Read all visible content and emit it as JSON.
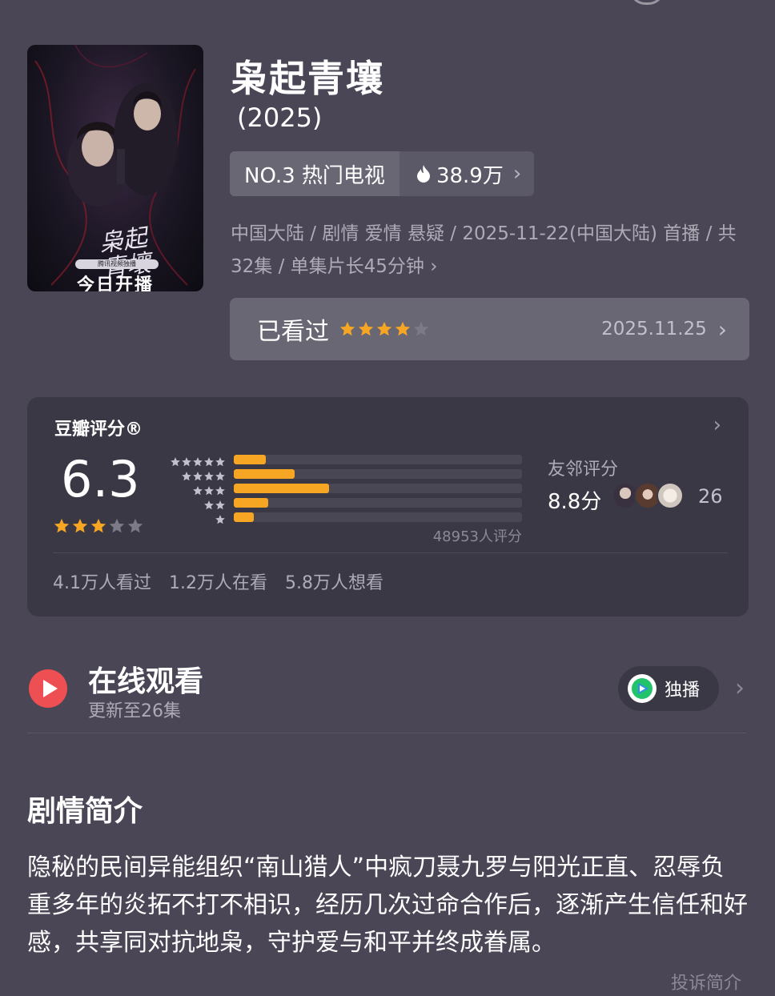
{
  "show": {
    "title": "枭起青壤",
    "year": "(2025)",
    "rank_label": "NO.3 热门电视",
    "heat": "38.9万",
    "meta_line1": "中国大陆 / 剧情 爱情 悬疑 / 2025-11-22(中国大陆) 首播 / 共",
    "meta_line2": "32集 / 单集片长45分钟",
    "poster": {
      "vertical_title": "枭起青壤",
      "banner": "腾讯视频独播",
      "today": "今日开播"
    }
  },
  "watched": {
    "label": "已看过",
    "user_rating_stars": 4,
    "date": "2025.11.25"
  },
  "rating": {
    "brand": "豆瓣评分®",
    "score": "6.3",
    "score_stars": 3,
    "distribution_percent": [
      11,
      21,
      33,
      12,
      7
    ],
    "votes": "48953人评分",
    "friends_label": "友邻评分",
    "friends_score": "8.8分",
    "friends_count": "26",
    "seen": "4.1万人看过",
    "watching": "1.2万人在看",
    "want": "5.8万人想看"
  },
  "online": {
    "title": "在线观看",
    "subtitle": "更新至26集",
    "exclusive_label": "独播"
  },
  "synopsis": {
    "heading": "剧情简介",
    "text": "隐秘的民间异能组织“南山猎人”中疯刀聂九罗与阳光正直、忍辱负重多年的炎拓不打不相识，经历几次过命合作后，逐渐产生信任和好感，共享同对抗地枭，守护爱与和平并终成眷属。",
    "report": "投诉简介"
  },
  "colors": {
    "background": "#4a4656",
    "accent_star": "#f6a623",
    "play_red": "#ee4f52"
  }
}
